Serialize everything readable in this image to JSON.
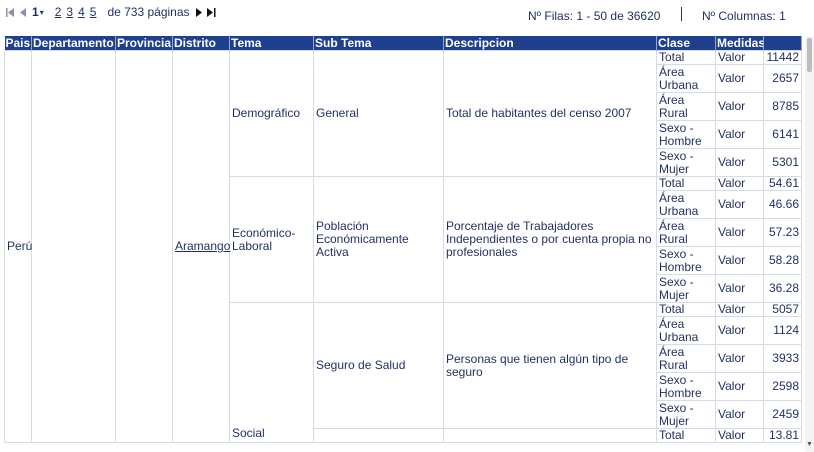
{
  "pager": {
    "current": "1",
    "dropdown_glyph": "▾",
    "pages": [
      "2",
      "3",
      "4",
      "5"
    ],
    "of_pages": "de 733 páginas"
  },
  "status": {
    "rows": "Nº Filas: 1 - 50 de 36620",
    "cols": "Nº Columnas: 1"
  },
  "table": {
    "headers": [
      "Pais",
      "Departamento",
      "Provincia",
      "Distrito",
      "Tema",
      "Sub Tema",
      "Descripcion",
      "Clase",
      "Medidas",
      ""
    ],
    "pais": "Perú",
    "distrito": "Aramango",
    "groups": [
      {
        "tema": "Demográfico",
        "subtema": "General",
        "descripcion": "Total de habitantes del censo 2007",
        "rows": [
          {
            "clase": "Total",
            "medida": "Valor",
            "valor": "11442"
          },
          {
            "clase": "Área Urbana",
            "medida": "Valor",
            "valor": "2657"
          },
          {
            "clase": "Área Rural",
            "medida": "Valor",
            "valor": "8785"
          },
          {
            "clase": "Sexo - Hombre",
            "medida": "Valor",
            "valor": "6141"
          },
          {
            "clase": "Sexo - Mujer",
            "medida": "Valor",
            "valor": "5301"
          }
        ]
      },
      {
        "tema": "Económico-Laboral",
        "subtema": "Población Económicamente Activa",
        "descripcion": "Porcentaje de Trabajadores Independientes o por cuenta propia no profesionales",
        "rows": [
          {
            "clase": "Total",
            "medida": "Valor",
            "valor": "54.61"
          },
          {
            "clase": "Área Urbana",
            "medida": "Valor",
            "valor": "46.66"
          },
          {
            "clase": "Área Rural",
            "medida": "Valor",
            "valor": "57.23"
          },
          {
            "clase": "Sexo - Hombre",
            "medida": "Valor",
            "valor": "58.28"
          },
          {
            "clase": "Sexo - Mujer",
            "medida": "Valor",
            "valor": "36.28"
          }
        ]
      },
      {
        "tema": "Social",
        "subtema": "Seguro de Salud",
        "descripcion": "Personas que tienen algún tipo de seguro",
        "rows": [
          {
            "clase": "Total",
            "medida": "Valor",
            "valor": "5057"
          },
          {
            "clase": "Área Urbana",
            "medida": "Valor",
            "valor": "1124"
          },
          {
            "clase": "Área Rural",
            "medida": "Valor",
            "valor": "3933"
          },
          {
            "clase": "Sexo - Hombre",
            "medida": "Valor",
            "valor": "2598"
          },
          {
            "clase": "Sexo - Mujer",
            "medida": "Valor",
            "valor": "2459"
          }
        ]
      }
    ],
    "partial_row": {
      "clase": "Total",
      "medida": "Valor",
      "valor": "13.81"
    }
  },
  "icons": {
    "first": "first-page-icon",
    "prev": "prev-page-icon",
    "next": "next-page-icon",
    "last": "last-page-icon"
  },
  "colors": {
    "header_bg": "#1f3f8f",
    "text": "#1f2f5f",
    "grid_line": "#d6dbe8"
  }
}
